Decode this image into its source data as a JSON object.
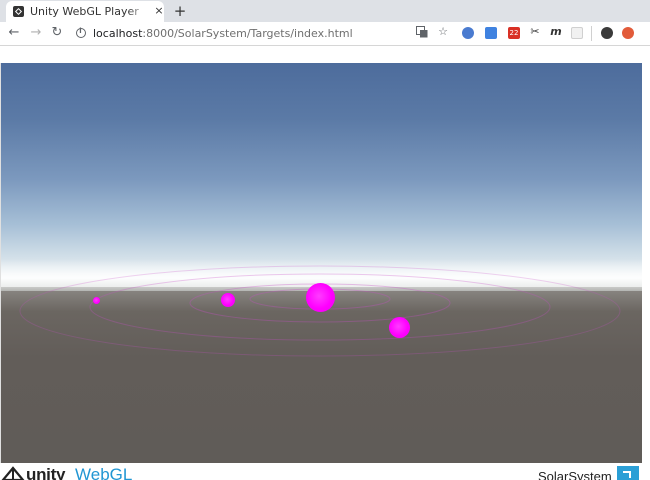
{
  "browser": {
    "tab": {
      "title": "Unity WebGL Player | SolarSystem",
      "favicon": "unity-icon",
      "close_label": "×"
    },
    "new_tab_label": "+",
    "nav": {
      "back_label": "←",
      "forward_label": "→",
      "reload_label": "↻"
    },
    "address": {
      "host": "localhost",
      "path": ":8000/SolarSystem/Targets/index.html"
    },
    "toolbar_icons": [
      "translate-icon",
      "bookmark-star-icon",
      "extension-icon",
      "extension-icon",
      "gmail-icon",
      "scissors-icon",
      "extension-m-icon",
      "extension-icon",
      "profile-avatar-icon",
      "record-icon"
    ],
    "gmail_badge": "22",
    "ext_m_label": "m"
  },
  "scene": {
    "sky_top_color": "#4d6c9c",
    "ground_color": "#625d59",
    "planet_color": "#ff00ff",
    "planet_count": 4
  },
  "footer": {
    "brand_unity": "unity",
    "brand_webgl": "WebGL",
    "title": "SolarSystem",
    "fullscreen_icon": "fullscreen-icon",
    "accent_color": "#2b9fd6"
  }
}
